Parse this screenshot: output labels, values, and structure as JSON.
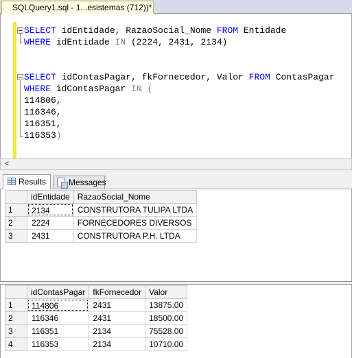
{
  "document_tab": {
    "title": "SQLQuery1.sql - 1...esistemas (712))*"
  },
  "editor": {
    "line1": {
      "kw1": "SELECT",
      "t1": " idEntidade, RazaoSocial_Nome ",
      "kw2": "FROM",
      "t2": " Entidade"
    },
    "line2": {
      "kw1": "WHERE",
      "t1": " idEntidade ",
      "kw2": "IN",
      "t2": " (2224, 2431, 2134)"
    },
    "line4": {
      "kw1": "SELECT",
      "t1": " idContasPagar, fkFornecedor, Valor ",
      "kw2": "FROM",
      "t2": " ContasPagar"
    },
    "line5": {
      "kw1": "WHERE",
      "t1": " idContasPagar ",
      "kw2": "IN",
      "t2": " ("
    },
    "line6": "114806,",
    "line7": "116346,",
    "line8": "116351,",
    "line9": {
      "value": "116353",
      "paren": ")"
    }
  },
  "scrollbar": {
    "left_arrow": "<"
  },
  "result_tabs": {
    "results": "Results",
    "messages": "Messages"
  },
  "grid1": {
    "columns": [
      "idEntidade",
      "RazaoSocial_Nome"
    ],
    "rows": [
      {
        "num": "1",
        "cells": [
          "2134",
          "CONSTRUTORA TULIPA LTDA"
        ]
      },
      {
        "num": "2",
        "cells": [
          "2224",
          "FORNECEDORES DIVERSOS"
        ]
      },
      {
        "num": "3",
        "cells": [
          "2431",
          "CONSTRUTORA P.H. LTDA"
        ]
      }
    ]
  },
  "grid2": {
    "columns": [
      "idContasPagar",
      "fkFornecedor",
      "Valor"
    ],
    "rows": [
      {
        "num": "1",
        "cells": [
          "114806",
          "2431",
          "13875.00"
        ]
      },
      {
        "num": "2",
        "cells": [
          "116346",
          "2431",
          "18500.00"
        ]
      },
      {
        "num": "3",
        "cells": [
          "116351",
          "2134",
          "75528.00"
        ]
      },
      {
        "num": "4",
        "cells": [
          "116353",
          "2134",
          "10710.00"
        ]
      }
    ]
  },
  "colors": {
    "keyword": "#0000ff",
    "operator": "#808080",
    "change_bar": "#f1ea3b"
  }
}
